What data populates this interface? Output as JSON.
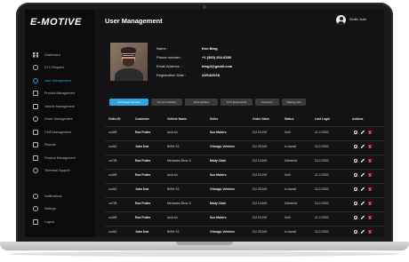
{
  "brand": "E-MOTIVE",
  "sidebar": {
    "items": [
      {
        "label": "Dashboard",
        "icon": "dashboard-icon",
        "active": false
      },
      {
        "label": "KYC Request",
        "icon": "kyc-icon",
        "active": false
      },
      {
        "label": "User Management",
        "icon": "user-icon",
        "active": true
      },
      {
        "label": "Product Management",
        "icon": "product-icon",
        "active": false
      },
      {
        "label": "Vehicle Management",
        "icon": "vehicle-icon",
        "active": false
      },
      {
        "label": "Driver Management",
        "icon": "driver-icon",
        "active": false
      },
      {
        "label": "CMS Management",
        "icon": "cms-icon",
        "active": false
      },
      {
        "label": "Reports",
        "icon": "reports-icon",
        "active": false
      },
      {
        "label": "Finance Management",
        "icon": "finance-icon",
        "active": false
      },
      {
        "label": "Technical Support",
        "icon": "support-icon",
        "active": false
      }
    ],
    "bottom": [
      {
        "label": "Notifications",
        "icon": "bell-icon"
      },
      {
        "label": "Settings",
        "icon": "gear-icon"
      },
      {
        "label": "Logout",
        "icon": "logout-icon"
      }
    ]
  },
  "header": {
    "title": "User Management",
    "user_name": "Smith John"
  },
  "profile": {
    "name_label": "Name :",
    "name": "Ken Bing",
    "phone_label": "Phone number :",
    "phone": "+1 (360) 204-6390",
    "email_label": "Email Address :",
    "email": "bing4@gmail.com",
    "reg_label": "Registration Date :",
    "reg_date": "23/04/2018"
  },
  "tabs": [
    "Purchased vehicles",
    "On rent vehicles",
    "Sold vehicles",
    "KYC Documents",
    "Inventory",
    "Making post"
  ],
  "table": {
    "headers": [
      "Order ID",
      "Customer",
      "Vehicle Name",
      "Seller",
      "Order Value",
      "Status",
      "Last Login",
      "Actions"
    ],
    "rows": [
      [
        "uu365",
        "Ron Potter",
        "Audi A4",
        "Sue Motors",
        "CU 15,200",
        "Sold",
        "21-2-2020"
      ],
      [
        "uu461",
        "John Doe",
        "BMW X3",
        "Chicago Vehicles",
        "CU 25,300",
        "In-transit",
        "22-2-2020"
      ],
      [
        "uu728",
        "Ron Potter",
        "Mercedes Benz G",
        "Mady Clark",
        "CU 13,500",
        "Delivered",
        "23-2-2020"
      ],
      [
        "uu365",
        "Ron Potter",
        "Audi A4",
        "Sue Motors",
        "CU 15,200",
        "Sold",
        "21-2-2020"
      ],
      [
        "uu461",
        "John Doe",
        "BMW X3",
        "Chicago Vehicles",
        "CU 25,300",
        "In-transit",
        "22-2-2020"
      ],
      [
        "uu728",
        "Ron Potter",
        "Mercedes Benz G",
        "Mady Clark",
        "CU 13,500",
        "Delivered",
        "23-2-2020"
      ],
      [
        "uu365",
        "Ron Potter",
        "Audi A4",
        "Sue Motors",
        "CU 15,200",
        "Sold",
        "21-2-2020"
      ],
      [
        "uu461",
        "John Doe",
        "BMW X3",
        "Chicago Vehicles",
        "CU 25,300",
        "In-transit",
        "22-2-2020"
      ]
    ]
  },
  "colors": {
    "accent": "#2ea4e0",
    "danger": "#d83a3a",
    "background": "#131315"
  }
}
